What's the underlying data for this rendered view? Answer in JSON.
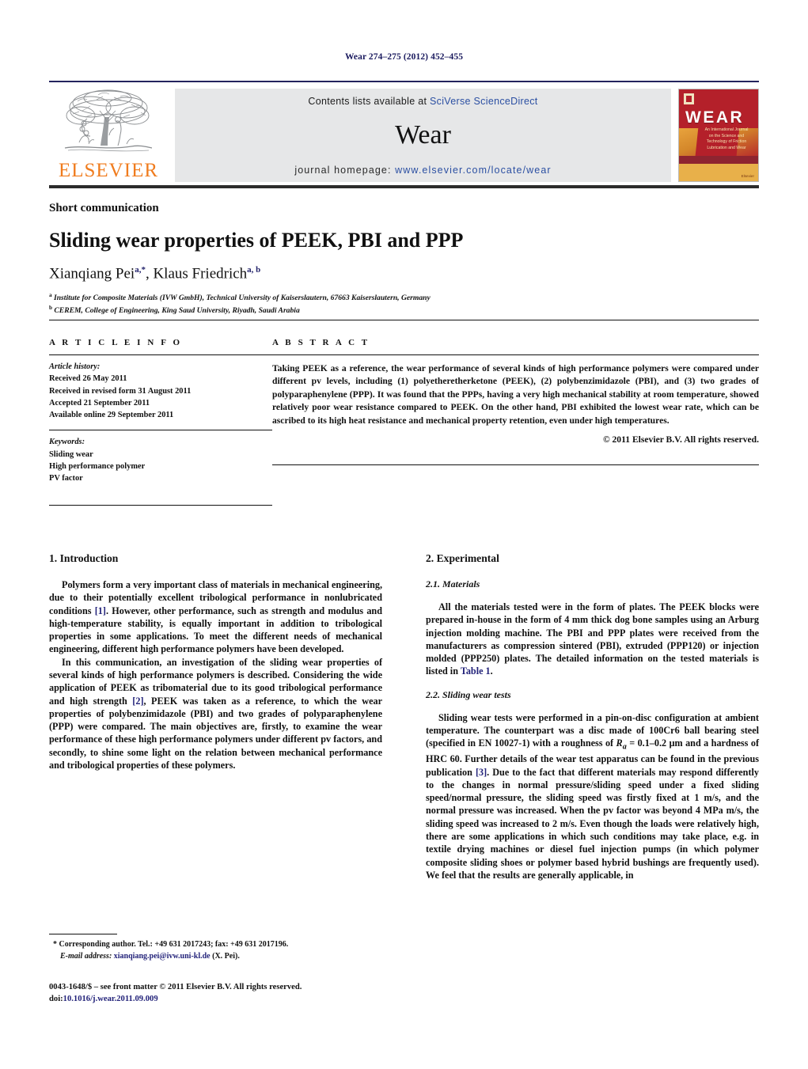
{
  "running_head": "Wear 274–275 (2012) 452–455",
  "masthead": {
    "contents_prefix": "Contents lists available at ",
    "contents_link": "SciVerse ScienceDirect",
    "journal_name": "Wear",
    "homepage_prefix": "journal homepage: ",
    "homepage_url": "www.elsevier.com/locate/wear",
    "publisher_wordmark": "ELSEVIER",
    "cover": {
      "title": "WEAR",
      "subtitle": "An International Journal on the Science and Technology of Friction Lubrication and Wear",
      "footer": "Elsevier"
    }
  },
  "article": {
    "type": "Short communication",
    "title": "Sliding wear properties of PEEK, PBI and PPP",
    "authors_1": "Xianqiang Pei",
    "authors_1_sup": "a,*",
    "authors_sep": ", ",
    "authors_2": "Klaus Friedrich",
    "authors_2_sup": "a, b",
    "affiliation_a_sup": "a",
    "affiliation_a": " Institute for Composite Materials (IVW GmbH), Technical University of Kaiserslautern, 67663 Kaiserslautern, Germany",
    "affiliation_b_sup": "b",
    "affiliation_b": " CEREM, College of Engineering, King Saud University, Riyadh, Saudi Arabia"
  },
  "article_info": {
    "heading": "A R T I C L E   I N F O",
    "history_label": "Article history:",
    "history": [
      "Received 26 May 2011",
      "Received in revised form 31 August 2011",
      "Accepted 21 September 2011",
      "Available online 29 September 2011"
    ],
    "keywords_label": "Keywords:",
    "keywords": [
      "Sliding wear",
      "High performance polymer",
      "PV factor"
    ]
  },
  "abstract": {
    "heading": "A B S T R A C T",
    "text": "Taking PEEK as a reference, the wear performance of several kinds of high performance polymers were compared under different pv levels, including (1) polyetheretherketone (PEEK), (2) polybenzimidazole (PBI), and (3) two grades of polyparaphenylene (PPP). It was found that the PPPs, having a very high mechanical stability at room temperature, showed relatively poor wear resistance compared to PEEK. On the other hand, PBI exhibited the lowest wear rate, which can be ascribed to its high heat resistance and mechanical property retention, even under high temperatures.",
    "copyright": "© 2011 Elsevier B.V. All rights reserved."
  },
  "sections": {
    "intro_heading": "1.  Introduction",
    "intro_p1_a": "Polymers form a very important class of materials in mechanical engineering, due to their potentially excellent tribological performance in nonlubricated conditions ",
    "intro_p1_ref": "[1]",
    "intro_p1_b": ". However, other performance, such as strength and modulus and high-temperature stability, is equally important in addition to tribological properties in some applications. To meet the different needs of mechanical engineering, different high performance polymers have been developed.",
    "intro_p2_a": "In this communication, an investigation of the sliding wear properties of several kinds of high performance polymers is described. Considering the wide application of PEEK as tribomaterial due to its good tribological performance and high strength ",
    "intro_p2_ref": "[2]",
    "intro_p2_b": ", PEEK was taken as a reference, to which the wear properties of polybenzimidazole (PBI) and two grades of polyparaphenylene (PPP) were compared. The main objectives are, firstly, to examine the wear performance of these high performance polymers under different pv factors, and secondly, to shine some light on the relation between mechanical performance and tribological properties of these polymers.",
    "exp_heading": "2.  Experimental",
    "materials_heading": "2.1.  Materials",
    "materials_p_a": "All the materials tested were in the form of plates. The PEEK blocks were prepared in-house in the form of 4 mm thick dog bone samples using an Arburg injection molding machine. The PBI and PPP plates were received from the manufacturers as compression sintered (PBI), extruded (PPP120) or injection molded (PPP250) plates. The detailed information on the tested materials is listed in ",
    "materials_p_ref": "Table 1",
    "materials_p_b": ".",
    "tests_heading": "2.2.  Sliding wear tests",
    "tests_p_a": "Sliding wear tests were performed in a pin-on-disc configuration at ambient temperature. The counterpart was a disc made of 100Cr6 ball bearing steel (specified in EN 10027-1) with a roughness of ",
    "tests_p_Ra": "R",
    "tests_p_Ra_sub": "a",
    "tests_p_b": " = 0.1–0.2 μm and a hardness of HRC 60. Further details of the wear test apparatus can be found in the previous publication ",
    "tests_p_ref": "[3]",
    "tests_p_c": ". Due to the fact that different materials may respond differently to the changes in normal pressure/sliding speed under a fixed sliding speed/normal pressure, the sliding speed was firstly fixed at 1 m/s, and the normal pressure was increased. When the pv factor was beyond 4 MPa m/s, the sliding speed was increased to 2 m/s. Even though the loads were relatively high, there are some applications in which such conditions may take place, e.g. in textile drying machines or diesel fuel injection pumps (in which polymer composite sliding shoes or polymer based hybrid bushings are frequently used). We feel that the results are generally applicable, in"
  },
  "footnote": {
    "marker": "*",
    "corresponding": " Corresponding author. Tel.: +49 631 2017243; fax: +49 631 2017196.",
    "email_label": "E-mail address:",
    "email": "xianqiang.pei@ivw.uni-kl.de",
    "email_suffix": " (X. Pei)."
  },
  "imprint": {
    "line1": "0043-1648/$ – see front matter © 2011 Elsevier B.V. All rights reserved.",
    "doi_label": "doi:",
    "doi": "10.1016/j.wear.2011.09.009"
  },
  "colors": {
    "link_blue": "#23237a",
    "elsevier_orange": "#F07C1E",
    "masthead_rule": "#23235e",
    "cover_red": "#b4202a",
    "cover_orange": "#e8b04a"
  }
}
